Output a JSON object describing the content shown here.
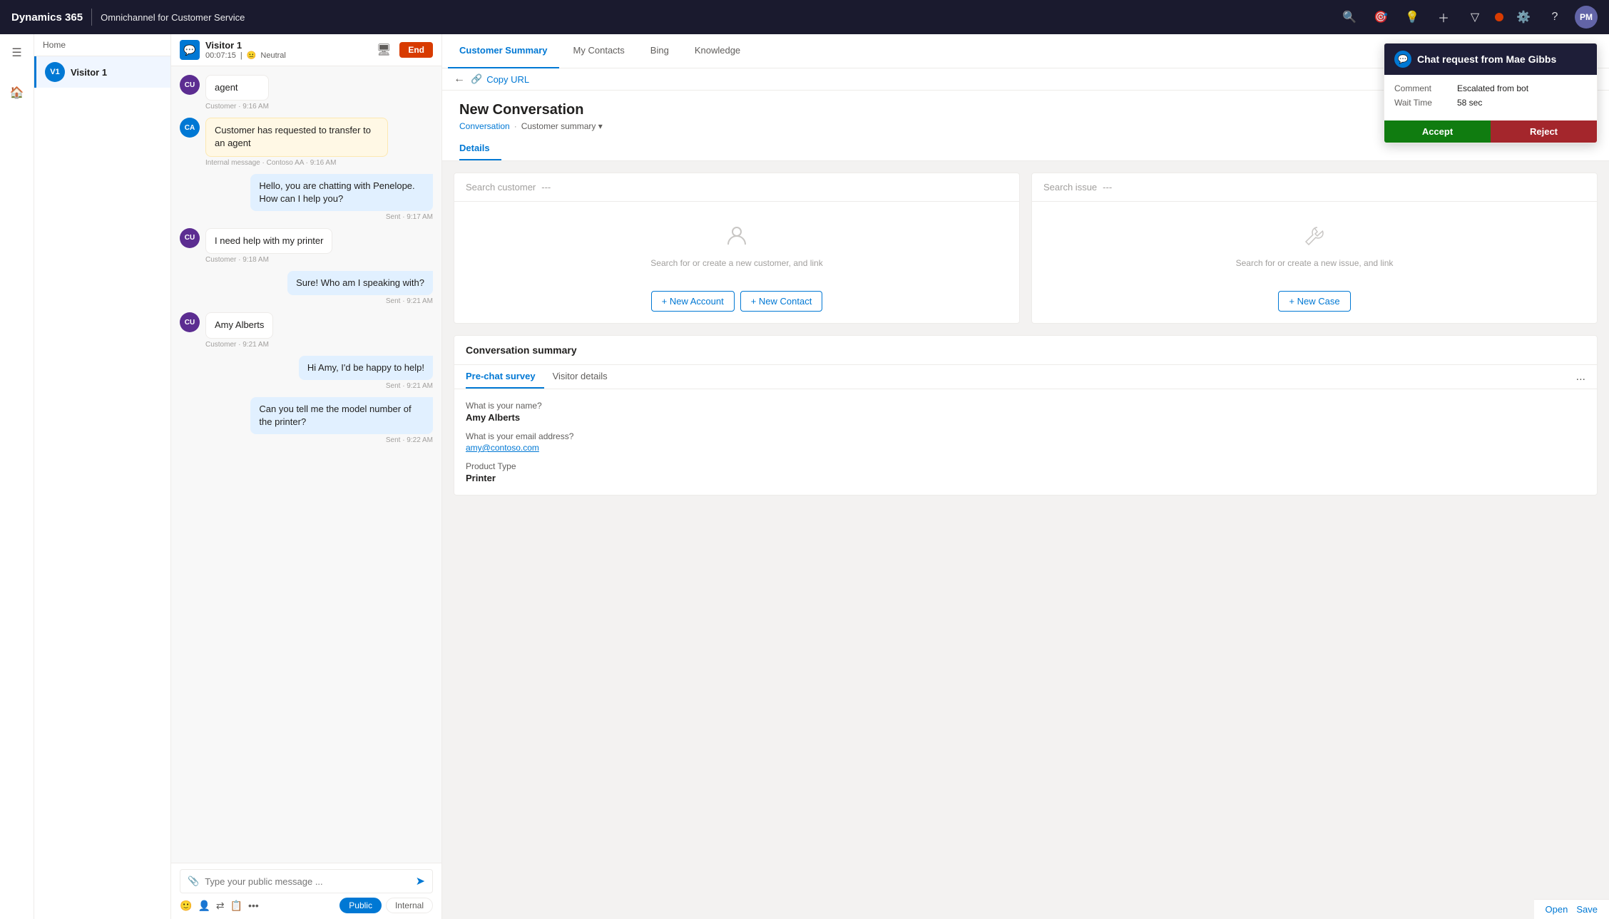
{
  "app": {
    "brand": "Dynamics 365",
    "app_name": "Omnichannel for Customer Service",
    "user_initials": "PM"
  },
  "topnav": {
    "icons": [
      "search",
      "target",
      "bulb",
      "plus",
      "filter",
      "settings",
      "help"
    ]
  },
  "sidebar": {
    "home_label": "Home",
    "visitor_label": "Visitor 1"
  },
  "visitor_item": {
    "initials": "V1",
    "name": "Visitor 1"
  },
  "chat_header": {
    "name": "Visitor 1",
    "timer": "00:07:15",
    "sentiment": "Neutral",
    "end_button": "End"
  },
  "messages": [
    {
      "type": "agent_system",
      "avatar": "CU",
      "text": "agent",
      "time": "Customer · 9:16 AM"
    },
    {
      "type": "internal",
      "avatar": "CA",
      "text": "Customer has requested to transfer to an agent",
      "time": "Internal message · Contoso AA · 9:16 AM"
    },
    {
      "type": "agent",
      "text": "Hello, you are chatting with Penelope. How can I help you?",
      "time": "Sent · 9:17 AM"
    },
    {
      "type": "customer",
      "avatar": "CU",
      "text": "I need help with my printer",
      "time": "Customer · 9:18 AM"
    },
    {
      "type": "agent",
      "text": "Sure! Who am I speaking with?",
      "time": "Sent · 9:21 AM"
    },
    {
      "type": "customer",
      "avatar": "CU",
      "text": "Amy Alberts",
      "time": "Customer · 9:21 AM"
    },
    {
      "type": "agent",
      "text": "Hi Amy, I'd be happy to help!",
      "time": "Sent · 9:21 AM"
    },
    {
      "type": "agent",
      "text": "Can you tell me the model number of the printer?",
      "time": "Sent · 9:22 AM"
    }
  ],
  "chat_input": {
    "placeholder": "Type your public message ...",
    "public_label": "Public",
    "internal_label": "Internal"
  },
  "content_tabs": [
    {
      "label": "Customer Summary",
      "active": true
    },
    {
      "label": "My Contacts",
      "active": false
    },
    {
      "label": "Bing",
      "active": false
    },
    {
      "label": "Knowledge",
      "active": false
    }
  ],
  "copy_url": {
    "label": "Copy URL"
  },
  "new_conversation": {
    "title": "New Conversation",
    "breadcrumb_part1": "Conversation",
    "breadcrumb_sep": "·",
    "breadcrumb_part2": "Customer summary",
    "details_tab": "Details"
  },
  "customer_card": {
    "search_placeholder": "Search customer",
    "search_dashes": "---",
    "empty_text": "Search for or create a new customer, and link",
    "new_account_btn": "+ New Account",
    "new_contact_btn": "+ New Contact"
  },
  "issue_card": {
    "search_placeholder": "Search issue",
    "search_dashes": "---",
    "empty_text": "Search for or create a new issue, and link",
    "new_case_btn": "+ New Case"
  },
  "conversation_summary": {
    "title": "Conversation summary",
    "tab_prechat": "Pre-chat survey",
    "tab_visitor": "Visitor details",
    "more": "...",
    "fields": [
      {
        "label": "What is your name?",
        "value": "Amy Alberts",
        "type": "bold"
      },
      {
        "label": "What is your email address?",
        "value": "amy@contoso.com",
        "type": "link"
      },
      {
        "label": "Product Type",
        "value": "Printer",
        "type": "bold"
      }
    ]
  },
  "notification": {
    "title": "Chat request from Mae Gibbs",
    "icon": "💬",
    "comment_label": "Comment",
    "comment_value": "Escalated from bot",
    "wait_label": "Wait Time",
    "wait_value": "58 sec",
    "accept_label": "Accept",
    "reject_label": "Reject"
  },
  "bottom_bar": {
    "open_label": "Open",
    "save_label": "Save"
  }
}
